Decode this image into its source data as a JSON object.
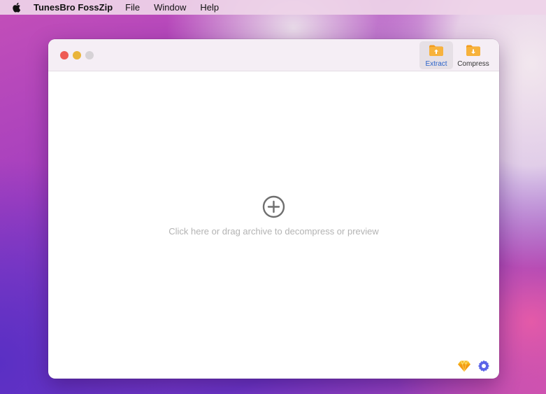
{
  "menubar": {
    "apple_icon": "apple-logo-icon",
    "app_name": "TunesBro FossZip",
    "items": [
      {
        "label": "File"
      },
      {
        "label": "Window"
      },
      {
        "label": "Help"
      }
    ]
  },
  "window": {
    "toolbar": {
      "extract_label": "Extract",
      "compress_label": "Compress",
      "extract_icon": "folder-upload-icon",
      "compress_icon": "folder-download-icon",
      "active_tool": "Extract"
    },
    "dropzone": {
      "icon": "plus-circle-icon",
      "hint": "Click here or drag archive to decompress or preview"
    },
    "footer": {
      "upgrade_icon": "diamond-icon",
      "settings_icon": "gear-icon"
    }
  },
  "colors": {
    "accent": "#2b63c9",
    "folder": "#f5a623",
    "diamond": "#f6b81c",
    "gear": "#5b63e8",
    "close": "#ee5b55",
    "minimize": "#e9b43a",
    "maximize": "#d6d2d6"
  }
}
